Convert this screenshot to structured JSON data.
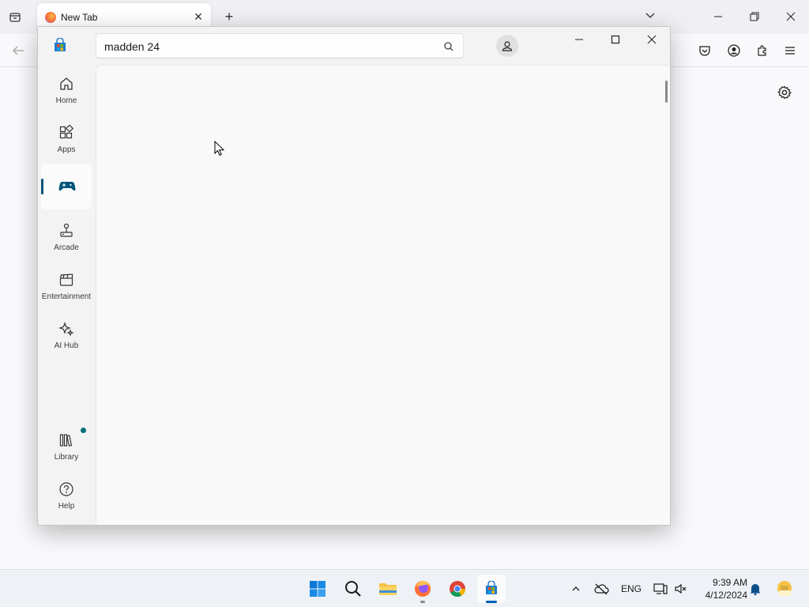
{
  "firefox": {
    "tab_title": "New Tab",
    "tab_close": "✕",
    "new_tab": "+",
    "icons": [
      "tab-list-icon",
      "back-icon",
      "pocket-icon",
      "account-icon",
      "extensions-icon",
      "menu-icon",
      "settings-icon"
    ]
  },
  "store": {
    "search_value": "madden 24",
    "nav": [
      {
        "label": "Home",
        "icon": "home-icon"
      },
      {
        "label": "Apps",
        "icon": "apps-icon"
      },
      {
        "label": "",
        "icon": "gaming-icon",
        "active": true
      },
      {
        "label": "Arcade",
        "icon": "arcade-icon"
      },
      {
        "label": "Entertainment",
        "icon": "entertainment-icon"
      },
      {
        "label": "AI Hub",
        "icon": "ai-hub-icon"
      },
      {
        "label": "Library",
        "icon": "library-icon",
        "notification_dot": true
      },
      {
        "label": "Help",
        "icon": "help-icon"
      }
    ],
    "accent": "#00557a"
  },
  "taskbar": {
    "language": "ENG",
    "time": "9:39 AM",
    "date": "4/12/2024",
    "apps": [
      "start-icon",
      "search-icon",
      "file-explorer-icon",
      "firefox-icon",
      "chrome-icon",
      "store-icon"
    ]
  }
}
